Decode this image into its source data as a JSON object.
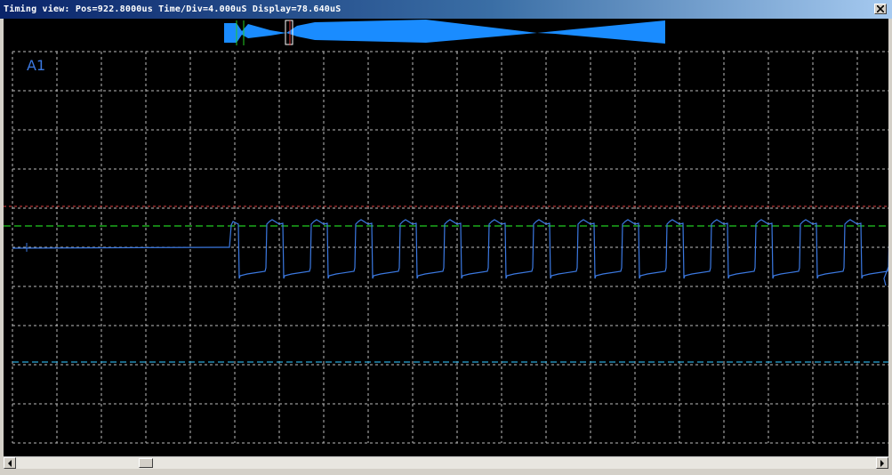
{
  "window": {
    "title": "Timing view: Pos=922.8000us Time/Div=4.000uS Display=78.640uS"
  },
  "scope": {
    "channel_label": "A1",
    "colors": {
      "background": "#000000",
      "grid": "#bdbdbd",
      "trace": "#3b78e0",
      "overview": "#1a8cff",
      "trigger_high": "#e04040",
      "threshold": "#22cc22",
      "trigger_low": "#2aa8d8"
    },
    "grid": "dashed"
  },
  "scrollbar": {
    "left_icon": "arrow-left-icon",
    "right_icon": "arrow-right-icon"
  }
}
